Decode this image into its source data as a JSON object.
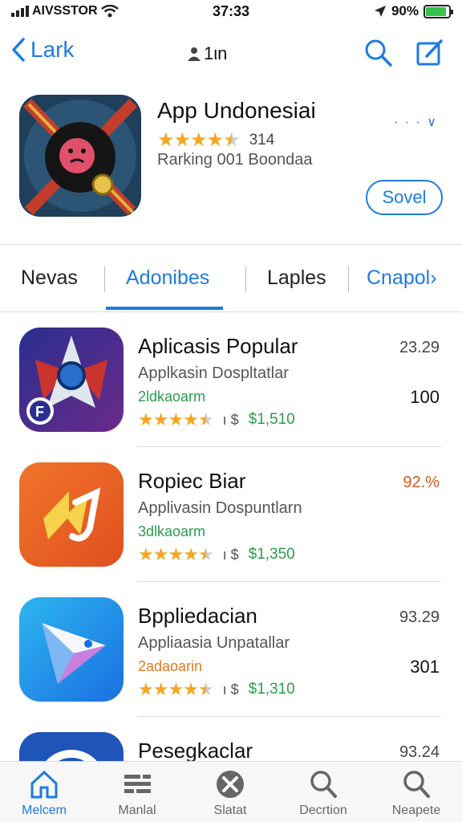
{
  "status_bar": {
    "carrier": "AIVSSTOR",
    "time": "37:33",
    "battery": "90%",
    "battery_level": 0.9
  },
  "nav": {
    "back_label": "Lark",
    "center_label": "1ιn"
  },
  "featured": {
    "title": "App Undonesiai",
    "stars": 4.5,
    "rating_count": "314",
    "subtitle": "Rarking 001 Boondaa",
    "more": "· · · ∨",
    "action_label": "Sovel"
  },
  "tabs": [
    {
      "label": "Nevas",
      "active": false
    },
    {
      "label": "Adonibes",
      "active": true
    },
    {
      "label": "Laples",
      "active": false
    },
    {
      "label": "Cnapol›",
      "active": false
    }
  ],
  "apps": [
    {
      "title": "Aplicasis Popular",
      "subtitle": "Applkasin Dospltatlar",
      "category": "2ldkaoarm",
      "category_color": "#2a9d4a",
      "stars": 4.5,
      "separator": "ı $",
      "price": "$1,510",
      "score": "23.29",
      "score_color": "#444444",
      "count": "100",
      "icon": "rocket-icon"
    },
    {
      "title": "Ropiec Biar",
      "subtitle": "Applivasin Dospuntlarn",
      "category": "3dlkaoarm",
      "category_color": "#2a9d4a",
      "stars": 4.5,
      "separator": "ı $",
      "price": "$1,350",
      "score": "92.%",
      "score_color": "#d25b1c",
      "count": "",
      "icon": "lightning-icon"
    },
    {
      "title": "Bppliedacian",
      "subtitle": "Appliaasia Unpatallar",
      "category": "2adaoarin",
      "category_color": "#e07a1e",
      "stars": 4.5,
      "separator": "ı $",
      "price": "$1,310",
      "score": "93.29",
      "score_color": "#444444",
      "count": "301",
      "icon": "play-arrow-icon"
    },
    {
      "title": "Pesegkaclar",
      "subtitle": "",
      "category": "",
      "category_color": "#2a9d4a",
      "stars": 0,
      "separator": "",
      "price": "",
      "score": "93.24",
      "score_color": "#444444",
      "count": "",
      "icon": "circle-logo-icon"
    }
  ],
  "tabbar": [
    {
      "label": "Melcem",
      "icon": "home-icon",
      "active": true
    },
    {
      "label": "Manlal",
      "icon": "list-icon",
      "active": false
    },
    {
      "label": "Slatat",
      "icon": "star-badge-icon",
      "active": false
    },
    {
      "label": "Decrtion",
      "icon": "search-icon",
      "active": false
    },
    {
      "label": "Neapete",
      "icon": "search-icon",
      "active": false
    }
  ],
  "colors": {
    "accent": "#1e7be0",
    "star": "#f5a623",
    "price_green": "#2a9d4a"
  }
}
